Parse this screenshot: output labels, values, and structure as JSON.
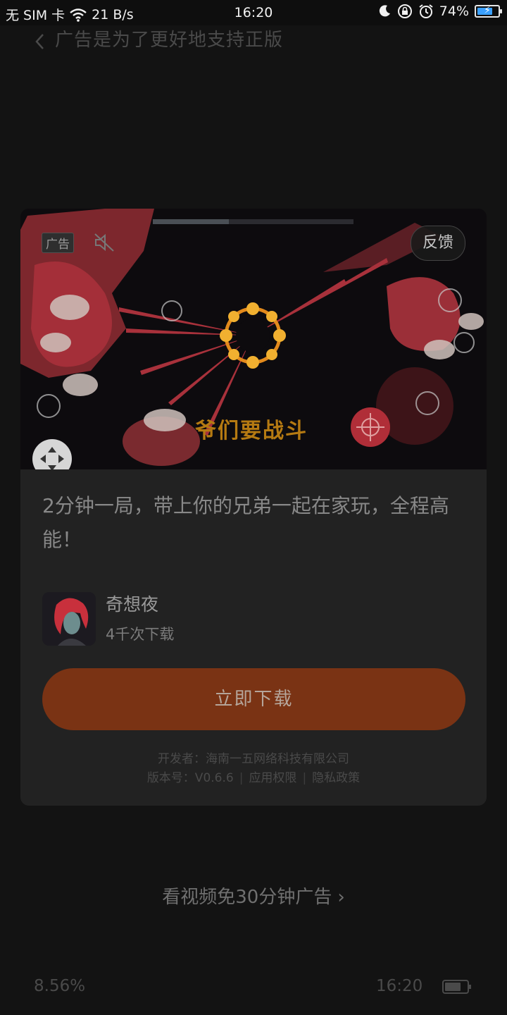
{
  "status_bar": {
    "carrier": "无 SIM 卡",
    "net_speed": "21 B/s",
    "time": "16:20",
    "battery": "74%",
    "battery_level": 0.74,
    "icons": [
      "wifi-icon",
      "moon-icon",
      "rotation-lock-icon",
      "alarm-icon",
      "battery-icon"
    ]
  },
  "topbar": {
    "back_icon": "chevron-left-icon",
    "title": "广告是为了更好地支持正版"
  },
  "ad": {
    "badge": "广告",
    "mute_icon": "speaker-muted-icon",
    "feedback": "反馈",
    "video_overlay_text": "爷们要战斗",
    "description": "2分钟一局，带上你的兄弟一起在家玩，全程高能！",
    "app": {
      "name": "奇想夜",
      "downloads": "4千次下载"
    },
    "download_button": "立即下载",
    "developer_line": "开发者：海南一五网络科技有限公司",
    "version": "版本号：V0.6.6",
    "permissions_link": "应用权限",
    "privacy_link": "隐私政策",
    "separator": "|"
  },
  "watch_video": {
    "label": "看视频免30分钟广告",
    "arrow": "›"
  },
  "reader_footer": {
    "progress": "8.56%",
    "time": "16:20",
    "battery_level": 0.74
  },
  "colors": {
    "background": "#131313",
    "card": "#222222",
    "download_button": "#7a3314",
    "video_accent": "#c84050"
  }
}
